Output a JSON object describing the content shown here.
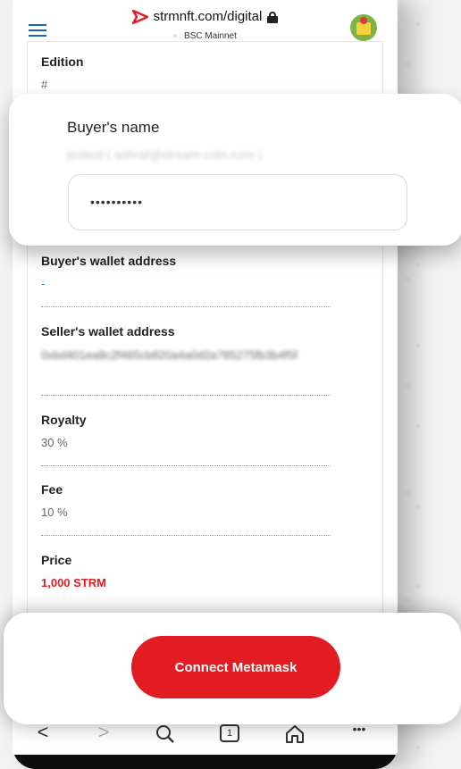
{
  "browser": {
    "url": "strmnft.com/digital",
    "network": "BSC Mainnet"
  },
  "fields": {
    "edition": {
      "label": "Edition",
      "value": "#"
    },
    "buyer_wallet": {
      "label": "Buyer's wallet address",
      "value": "-"
    },
    "seller_wallet": {
      "label": "Seller's wallet address",
      "value": "0xbd401ea8c2f465cb820a4a0d2a785275fb3b4f5f"
    },
    "royalty": {
      "label": "Royalty",
      "value": "30 %"
    },
    "fee": {
      "label": "Fee",
      "value": "10 %"
    },
    "price": {
      "label": "Price",
      "value": "1,000 STRM"
    }
  },
  "buyer_name_card": {
    "label": "Buyer's name",
    "value": "jestest ( ashraf@stream-coin.com )",
    "password_mask": "••••••••••"
  },
  "actions": {
    "connect_label": "Connect Metamask"
  },
  "navbar": {
    "back": "<",
    "forward": ">",
    "tabs_count": "1",
    "more": "•••"
  },
  "colors": {
    "accent": "#e31b23",
    "menu": "#1565c0",
    "link_blue": "#1976d2"
  }
}
